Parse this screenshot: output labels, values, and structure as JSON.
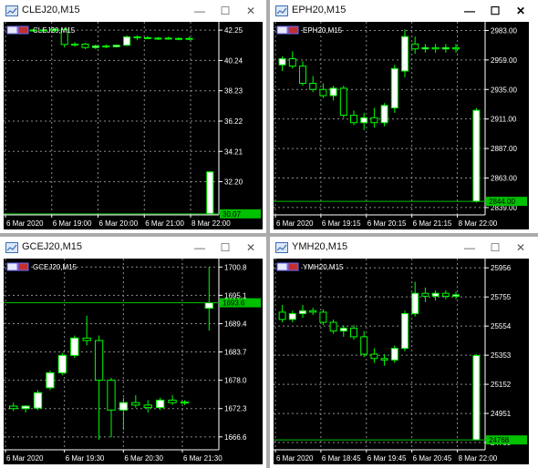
{
  "windows": [
    {
      "title": "CLEJ20,M15",
      "label": "CLEJ20,M15",
      "active": false,
      "price_labels": [
        "42.25",
        "40.24",
        "38.23",
        "36.22",
        "34.21",
        "32.20"
      ],
      "price_range": [
        30.0,
        42.8
      ],
      "current_price": "30.07",
      "current_value": 30.07,
      "time_labels": [
        "6 Mar 2020",
        "6 Mar 19:00",
        "6 Mar 20:00",
        "6 Mar 21:00",
        "8 Mar 22:00"
      ],
      "candles": [
        {
          "o": 42.28,
          "h": 42.34,
          "l": 42.2,
          "c": 42.25
        },
        {
          "o": 42.25,
          "h": 42.3,
          "l": 42.18,
          "c": 42.22
        },
        {
          "o": 42.22,
          "h": 42.28,
          "l": 42.16,
          "c": 42.26
        },
        {
          "o": 42.26,
          "h": 42.32,
          "l": 42.18,
          "c": 42.2
        },
        {
          "o": 42.3,
          "h": 42.4,
          "l": 42.1,
          "c": 42.28
        },
        {
          "o": 42.28,
          "h": 42.4,
          "l": 41.1,
          "c": 41.3
        },
        {
          "o": 41.3,
          "h": 41.45,
          "l": 41.15,
          "c": 41.32
        },
        {
          "o": 41.32,
          "h": 41.4,
          "l": 41.0,
          "c": 41.1
        },
        {
          "o": 41.1,
          "h": 41.3,
          "l": 41.0,
          "c": 41.2
        },
        {
          "o": 41.2,
          "h": 41.3,
          "l": 41.05,
          "c": 41.15
        },
        {
          "o": 41.15,
          "h": 41.3,
          "l": 41.1,
          "c": 41.25
        },
        {
          "o": 41.25,
          "h": 41.9,
          "l": 41.2,
          "c": 41.8
        },
        {
          "o": 41.8,
          "h": 41.9,
          "l": 41.6,
          "c": 41.75
        },
        {
          "o": 41.75,
          "h": 41.85,
          "l": 41.65,
          "c": 41.7
        },
        {
          "o": 41.7,
          "h": 41.8,
          "l": 41.6,
          "c": 41.72
        },
        {
          "o": 41.72,
          "h": 41.82,
          "l": 41.62,
          "c": 41.68
        },
        {
          "o": 41.68,
          "h": 41.78,
          "l": 41.58,
          "c": 41.7
        },
        {
          "o": 41.7,
          "h": 41.8,
          "l": 41.6,
          "c": 41.65
        },
        {
          "gap": true
        },
        {
          "o": 30.07,
          "h": 32.9,
          "l": 30.07,
          "c": 32.85
        }
      ]
    },
    {
      "title": "EPH20,M15",
      "label": "EPH20,M15",
      "active": true,
      "price_labels": [
        "2983.00",
        "2959.00",
        "2935.00",
        "2911.00",
        "2887.00",
        "2863.00",
        "2839.00"
      ],
      "price_range": [
        2833,
        2990
      ],
      "current_price": "2844.00",
      "current_value": 2844.0,
      "time_labels": [
        "6 Mar 2020",
        "6 Mar 19:15",
        "6 Mar 20:15",
        "6 Mar 21:15",
        "8 Mar 22:00"
      ],
      "candles": [
        {
          "o": 2955,
          "h": 2962,
          "l": 2950,
          "c": 2960
        },
        {
          "o": 2960,
          "h": 2966,
          "l": 2952,
          "c": 2954
        },
        {
          "o": 2954,
          "h": 2958,
          "l": 2938,
          "c": 2940
        },
        {
          "o": 2940,
          "h": 2946,
          "l": 2933,
          "c": 2935
        },
        {
          "o": 2935,
          "h": 2940,
          "l": 2928,
          "c": 2930
        },
        {
          "o": 2930,
          "h": 2938,
          "l": 2926,
          "c": 2936
        },
        {
          "o": 2936,
          "h": 2938,
          "l": 2912,
          "c": 2914
        },
        {
          "o": 2914,
          "h": 2918,
          "l": 2906,
          "c": 2908
        },
        {
          "o": 2908,
          "h": 2916,
          "l": 2902,
          "c": 2912
        },
        {
          "o": 2912,
          "h": 2920,
          "l": 2904,
          "c": 2908
        },
        {
          "o": 2908,
          "h": 2924,
          "l": 2905,
          "c": 2922
        },
        {
          "o": 2920,
          "h": 2955,
          "l": 2916,
          "c": 2952
        },
        {
          "o": 2950,
          "h": 2984,
          "l": 2945,
          "c": 2978
        },
        {
          "o": 2972,
          "h": 2978,
          "l": 2964,
          "c": 2968
        },
        {
          "o": 2968,
          "h": 2972,
          "l": 2965,
          "c": 2969
        },
        {
          "o": 2969,
          "h": 2972,
          "l": 2965,
          "c": 2968
        },
        {
          "o": 2968,
          "h": 2972,
          "l": 2965,
          "c": 2969
        },
        {
          "o": 2969,
          "h": 2972,
          "l": 2965,
          "c": 2968
        },
        {
          "gap": true
        },
        {
          "o": 2844,
          "h": 2920,
          "l": 2843,
          "c": 2918
        }
      ]
    },
    {
      "title": "GCEJ20,M15",
      "label": "GCEJ20,M15",
      "active": false,
      "price_labels": [
        "1700.8",
        "1695.1",
        "1689.4",
        "1683.7",
        "1678.0",
        "1672.3",
        "1666.6"
      ],
      "price_range": [
        1664,
        1702.5
      ],
      "current_price": "1693.6",
      "current_value": 1693.6,
      "time_labels": [
        "6 Mar 2020",
        "6 Mar 19:30",
        "6 Mar 20:30",
        "6 Mar 21:30"
      ],
      "candles": [
        {
          "o": 1672.8,
          "h": 1673.5,
          "l": 1671.8,
          "c": 1672.3
        },
        {
          "o": 1672.3,
          "h": 1673.0,
          "l": 1671.5,
          "c": 1672.8
        },
        {
          "o": 1672.4,
          "h": 1676.0,
          "l": 1672.0,
          "c": 1675.5
        },
        {
          "o": 1676.5,
          "h": 1680.0,
          "l": 1676.0,
          "c": 1679.5
        },
        {
          "o": 1679.5,
          "h": 1683.5,
          "l": 1679.0,
          "c": 1683.0
        },
        {
          "o": 1683.0,
          "h": 1687.0,
          "l": 1682.5,
          "c": 1686.5
        },
        {
          "o": 1686.5,
          "h": 1691.0,
          "l": 1685.0,
          "c": 1686.0
        },
        {
          "o": 1686.0,
          "h": 1687.0,
          "l": 1666.0,
          "c": 1678.0
        },
        {
          "o": 1678.0,
          "h": 1678.5,
          "l": 1666.5,
          "c": 1672.0
        },
        {
          "o": 1672.0,
          "h": 1674.5,
          "l": 1668.0,
          "c": 1673.5
        },
        {
          "o": 1673.5,
          "h": 1675.0,
          "l": 1672.5,
          "c": 1673.0
        },
        {
          "o": 1673.0,
          "h": 1674.0,
          "l": 1671.5,
          "c": 1672.5
        },
        {
          "o": 1672.5,
          "h": 1674.5,
          "l": 1672.0,
          "c": 1674.0
        },
        {
          "o": 1674.0,
          "h": 1675.0,
          "l": 1673.0,
          "c": 1673.5
        },
        {
          "o": 1673.5,
          "h": 1674.0,
          "l": 1673.0,
          "c": 1673.6
        },
        {
          "gap": true
        },
        {
          "o": 1692.5,
          "h": 1700.8,
          "l": 1688.0,
          "c": 1693.6
        }
      ]
    },
    {
      "title": "YMH20,M15",
      "label": "YMH20,M15",
      "active": false,
      "price_labels": [
        "25956",
        "25755",
        "25554",
        "25353",
        "25152",
        "24951",
        "24750"
      ],
      "price_range": [
        24700,
        26020
      ],
      "current_price": "24768",
      "current_value": 24768,
      "time_labels": [
        "6 Mar 2020",
        "6 Mar 18:45",
        "6 Mar 19:45",
        "6 Mar 20:45",
        "8 Mar 22:00"
      ],
      "candles": [
        {
          "o": 25650,
          "h": 25700,
          "l": 25580,
          "c": 25600
        },
        {
          "o": 25600,
          "h": 25660,
          "l": 25580,
          "c": 25640
        },
        {
          "o": 25640,
          "h": 25700,
          "l": 25610,
          "c": 25660
        },
        {
          "o": 25660,
          "h": 25680,
          "l": 25630,
          "c": 25650
        },
        {
          "o": 25650,
          "h": 25670,
          "l": 25560,
          "c": 25580
        },
        {
          "o": 25580,
          "h": 25600,
          "l": 25500,
          "c": 25520
        },
        {
          "o": 25520,
          "h": 25560,
          "l": 25480,
          "c": 25540
        },
        {
          "o": 25540,
          "h": 25560,
          "l": 25460,
          "c": 25480
        },
        {
          "o": 25480,
          "h": 25520,
          "l": 25340,
          "c": 25360
        },
        {
          "o": 25360,
          "h": 25400,
          "l": 25300,
          "c": 25330
        },
        {
          "o": 25330,
          "h": 25360,
          "l": 25280,
          "c": 25320
        },
        {
          "o": 25320,
          "h": 25420,
          "l": 25300,
          "c": 25400
        },
        {
          "o": 25400,
          "h": 25660,
          "l": 25380,
          "c": 25640
        },
        {
          "o": 25640,
          "h": 25860,
          "l": 25620,
          "c": 25780
        },
        {
          "o": 25780,
          "h": 25820,
          "l": 25720,
          "c": 25760
        },
        {
          "o": 25760,
          "h": 25800,
          "l": 25730,
          "c": 25780
        },
        {
          "o": 25780,
          "h": 25800,
          "l": 25740,
          "c": 25760
        },
        {
          "o": 25760,
          "h": 25790,
          "l": 25740,
          "c": 25770
        },
        {
          "gap": true
        },
        {
          "o": 24768,
          "h": 25360,
          "l": 24766,
          "c": 25350
        }
      ]
    }
  ],
  "colors": {
    "chart_bg": "#000000",
    "grid": "#8c8c8c",
    "axis_text": "#ffffff",
    "candle_bull": "#ffffff",
    "candle_bear": "#000000",
    "candle_outline": "#00ff00",
    "price_line": "#00c000",
    "price_label_bg": "#00c000"
  }
}
